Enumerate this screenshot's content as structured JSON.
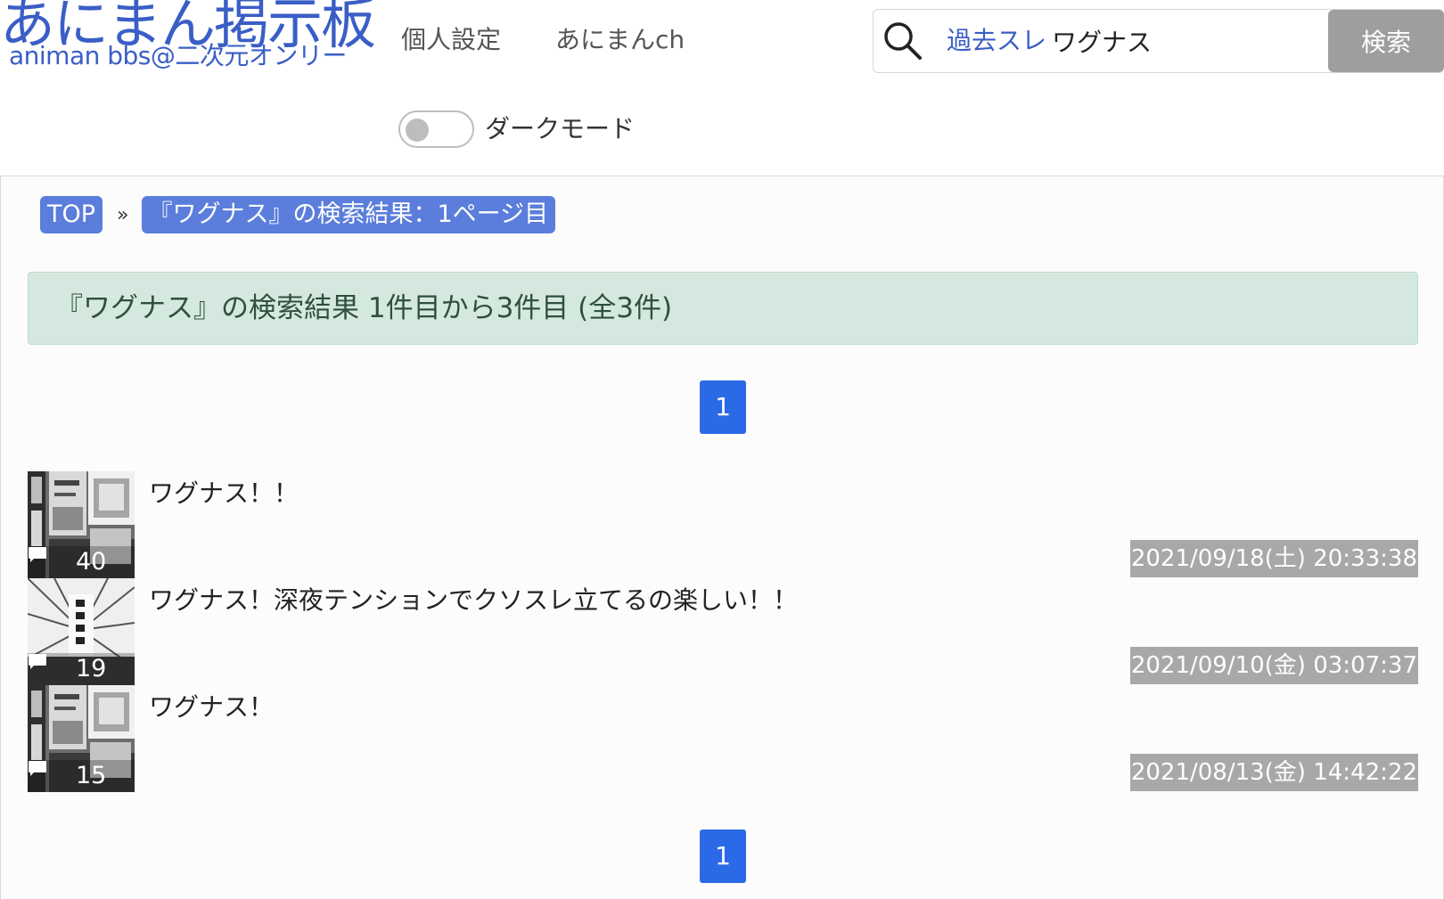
{
  "header": {
    "logo_title": "あにまん掲示板",
    "logo_subtitle": "animan bbs@二次元オンリー",
    "nav": {
      "settings": "個人設定",
      "animanch": "あにまんch"
    },
    "search": {
      "scope": "過去スレ",
      "query": "ワグナス",
      "button": "検索"
    },
    "dark_mode": {
      "label": "ダークモード",
      "enabled": false
    }
  },
  "breadcrumb": {
    "top": "TOP",
    "separator": "»",
    "current": "『ワグナス』の検索結果：1ページ目"
  },
  "result_summary": "『ワグナス』の検索結果 1件目から3件目 (全3件)",
  "pagination": {
    "pages": [
      "1"
    ],
    "current": "1"
  },
  "threads": [
    {
      "title": "ワグナス！！",
      "count": "40",
      "date": "2021/09/18(土) 20:33:38"
    },
    {
      "title": "ワグナス！深夜テンションでクソスレ立てるの楽しい！！",
      "count": "19",
      "date": "2021/09/10(金) 03:07:37"
    },
    {
      "title": "ワグナス！",
      "count": "15",
      "date": "2021/08/13(金) 14:42:22"
    }
  ],
  "colors": {
    "brand": "#3a5ec6",
    "breadcrumb_bg": "#5b7ddb",
    "pagination_active": "#2b6ae6",
    "alert_bg": "#d5e8df",
    "date_badge_bg": "#a8a8a8",
    "search_button_bg": "#9e9e9e"
  },
  "icons": {
    "search": "search-icon",
    "comment": "comment-icon",
    "thumbnail": "thread-thumbnail"
  }
}
